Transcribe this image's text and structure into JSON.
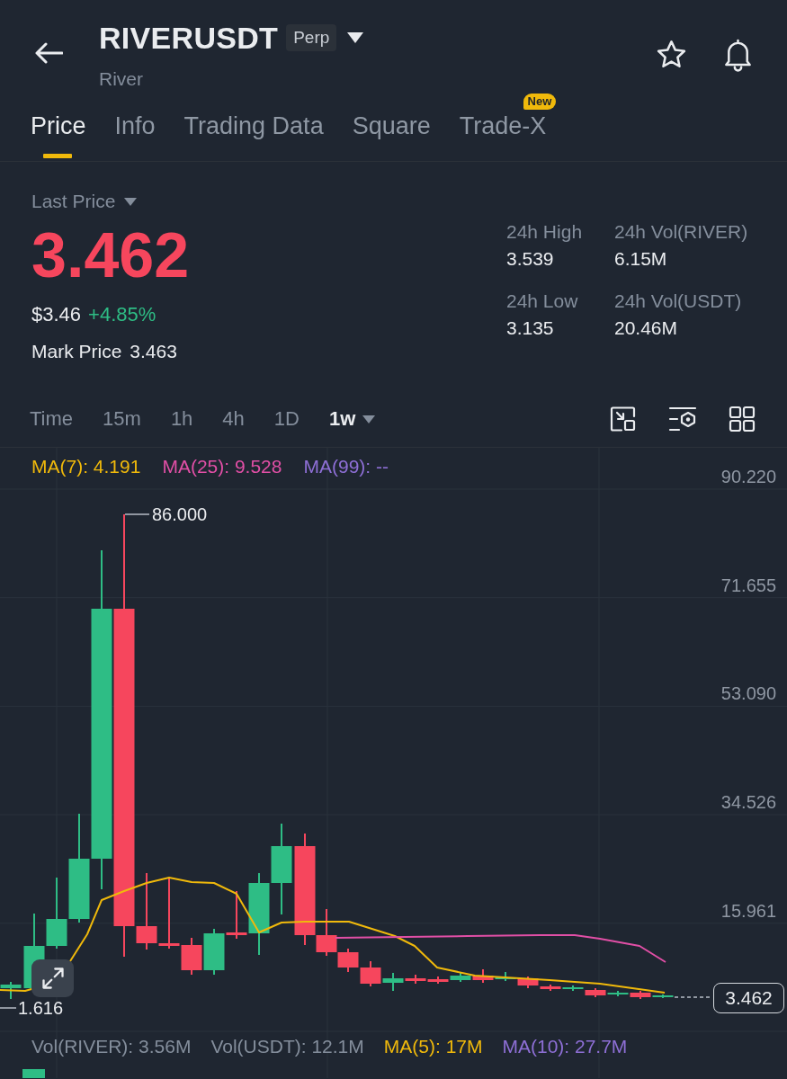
{
  "header": {
    "symbol": "RIVERUSDT",
    "contract_badge": "Perp",
    "name": "River"
  },
  "tabs": [
    {
      "label": "Price",
      "selected": true
    },
    {
      "label": "Info",
      "selected": false
    },
    {
      "label": "Trading Data",
      "selected": false
    },
    {
      "label": "Square",
      "selected": false
    },
    {
      "label": "Trade-X",
      "selected": false,
      "badge": "New"
    }
  ],
  "price": {
    "label": "Last Price",
    "last": {
      "text": "3.462",
      "color": "#f6465d"
    },
    "usd": "$3.46",
    "change": {
      "text": "+4.85%",
      "color": "#2ebd85"
    },
    "mark_label": "Mark Price",
    "mark": "3.463"
  },
  "stats": [
    {
      "label": "24h High",
      "value": "3.539"
    },
    {
      "label": "24h Vol(RIVER)",
      "value": "6.15M"
    },
    {
      "label": "24h Low",
      "value": "3.135"
    },
    {
      "label": "24h Vol(USDT)",
      "value": "20.46M"
    }
  ],
  "intervals": [
    {
      "label": "Time",
      "selected": false
    },
    {
      "label": "15m",
      "selected": false
    },
    {
      "label": "1h",
      "selected": false
    },
    {
      "label": "4h",
      "selected": false
    },
    {
      "label": "1D",
      "selected": false
    },
    {
      "label": "1w",
      "selected": true
    }
  ],
  "chart": {
    "indicators": [
      {
        "label": "MA(7): 4.191",
        "color": "#f0b90b"
      },
      {
        "label": "MA(25): 9.528",
        "color": "#e14fa6"
      },
      {
        "label": "MA(99): --",
        "color": "#8e6fd6"
      }
    ],
    "price_axis": [
      "90.220",
      "71.655",
      "53.090",
      "34.526",
      "15.961"
    ],
    "high_label": "86.000",
    "low_label": "1.616",
    "last_price_tag": "3.462",
    "volume_indicators": [
      {
        "label": "Vol(RIVER): 3.56M",
        "color": "#848e9c"
      },
      {
        "label": "Vol(USDT): 12.1M",
        "color": "#848e9c"
      },
      {
        "label": "MA(5): 17M",
        "color": "#f0b90b"
      },
      {
        "label": "MA(10): 27.7M",
        "color": "#8e6fd6"
      }
    ]
  }
}
